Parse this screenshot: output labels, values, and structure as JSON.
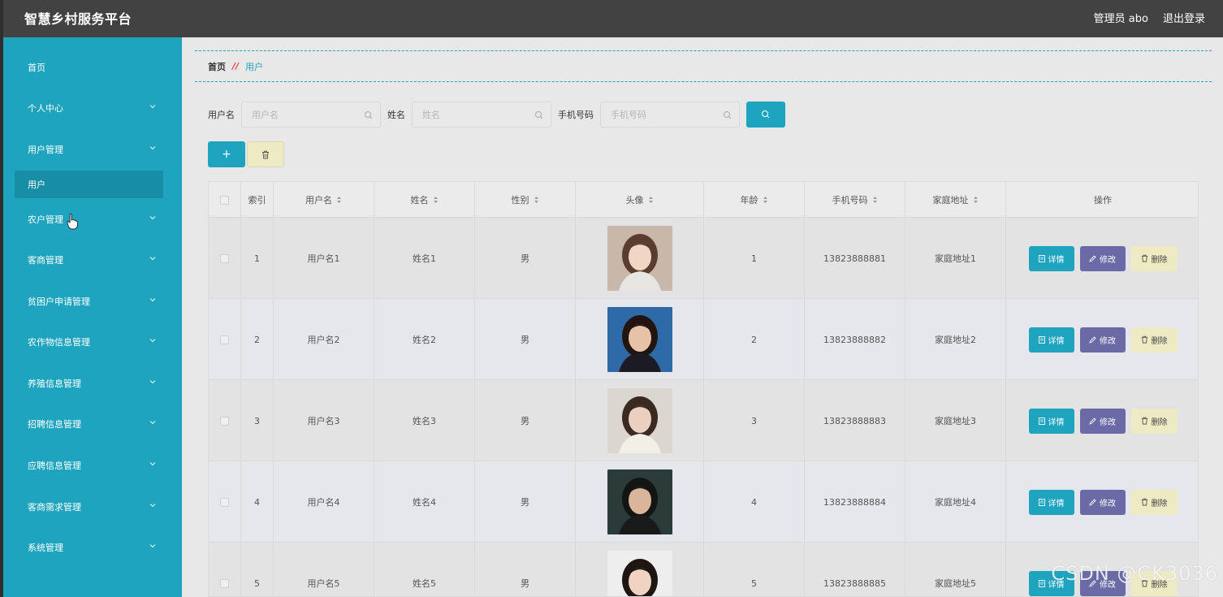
{
  "header": {
    "title": "智慧乡村服务平台",
    "user": "管理员 abo",
    "logout": "退出登录"
  },
  "sidebar": {
    "items": [
      {
        "label": "首页",
        "has_children": false
      },
      {
        "label": "个人中心",
        "has_children": true
      },
      {
        "label": "用户管理",
        "has_children": true
      },
      {
        "label": "农户管理",
        "has_children": true
      },
      {
        "label": "客商管理",
        "has_children": true
      },
      {
        "label": "贫困户申请管理",
        "has_children": true
      },
      {
        "label": "农作物信息管理",
        "has_children": true
      },
      {
        "label": "养殖信息管理",
        "has_children": true
      },
      {
        "label": "招聘信息管理",
        "has_children": true
      },
      {
        "label": "应聘信息管理",
        "has_children": true
      },
      {
        "label": "客商需求管理",
        "has_children": true
      },
      {
        "label": "系统管理",
        "has_children": true
      }
    ],
    "active_sub": "用户"
  },
  "breadcrumb": {
    "home": "首页",
    "separator": "//",
    "current": "用户"
  },
  "search": {
    "fields": [
      {
        "label": "用户名",
        "placeholder": "用户名"
      },
      {
        "label": "姓名",
        "placeholder": "姓名"
      },
      {
        "label": "手机号码",
        "placeholder": "手机号码"
      }
    ]
  },
  "actions": {
    "add": "+"
  },
  "table": {
    "columns": [
      "索引",
      "用户名",
      "姓名",
      "性别",
      "头像",
      "年龄",
      "手机号码",
      "家庭地址",
      "操作"
    ],
    "rows": [
      {
        "index": "1",
        "username": "用户名1",
        "name": "姓名1",
        "gender": "男",
        "age": "1",
        "phone": "13823888881",
        "address": "家庭地址1"
      },
      {
        "index": "2",
        "username": "用户名2",
        "name": "姓名2",
        "gender": "男",
        "age": "2",
        "phone": "13823888882",
        "address": "家庭地址2"
      },
      {
        "index": "3",
        "username": "用户名3",
        "name": "姓名3",
        "gender": "男",
        "age": "3",
        "phone": "13823888883",
        "address": "家庭地址3"
      },
      {
        "index": "4",
        "username": "用户名4",
        "name": "姓名4",
        "gender": "男",
        "age": "4",
        "phone": "13823888884",
        "address": "家庭地址4"
      },
      {
        "index": "5",
        "username": "用户名5",
        "name": "姓名5",
        "gender": "男",
        "age": "5",
        "phone": "13823888885",
        "address": "家庭地址5"
      }
    ],
    "ops": {
      "detail": "详情",
      "edit": "修改",
      "delete": "删除"
    }
  },
  "watermark": "CSDN @CK3036",
  "colors": {
    "header_bg": "#424242",
    "sidebar_bg": "#1fa4bf",
    "sidebar_active": "#178ea6",
    "accent": "#1fa4bf",
    "edit_button": "#6c6aa6",
    "delete_button": "#eeeac4",
    "breadcrumb_separator": "#e23a3a"
  }
}
